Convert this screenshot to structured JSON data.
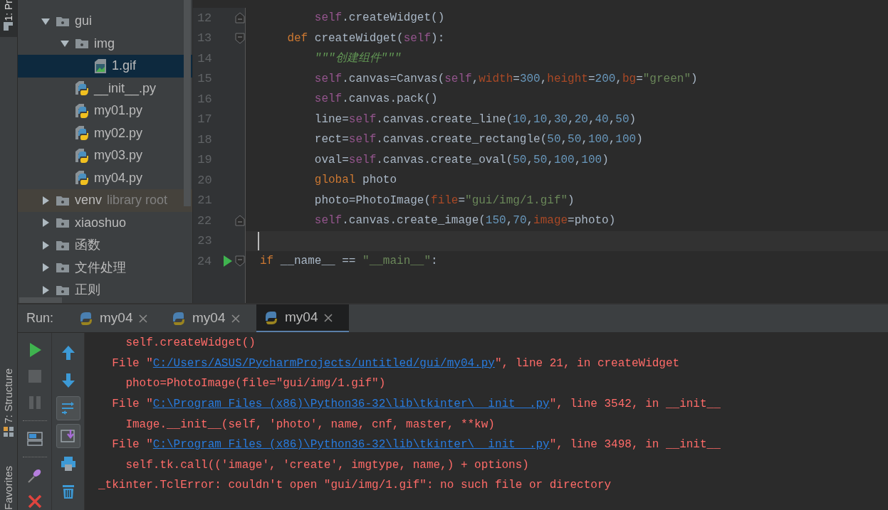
{
  "tool_strip": {
    "top_label": "1: Pr",
    "structure_label": "7: Structure",
    "favorites_label": "Favorites"
  },
  "project_tree": [
    {
      "kind": "folder",
      "label": "gui",
      "expanded": true,
      "selected": false,
      "children": [
        {
          "kind": "folder",
          "label": "img",
          "expanded": true,
          "selected": false,
          "children": [
            {
              "kind": "image",
              "label": "1.gif",
              "selected": true
            }
          ]
        },
        {
          "kind": "python",
          "label": "__init__.py",
          "selected": false
        },
        {
          "kind": "python",
          "label": "my01.py",
          "selected": false
        },
        {
          "kind": "python",
          "label": "my02.py",
          "selected": false
        },
        {
          "kind": "python",
          "label": "my03.py",
          "selected": false
        },
        {
          "kind": "python",
          "label": "my04.py",
          "selected": false
        }
      ]
    },
    {
      "kind": "folder",
      "label": "venv",
      "note": "library root",
      "expanded": false,
      "selected": false
    },
    {
      "kind": "folder",
      "label": "xiaoshuo",
      "expanded": false,
      "selected": false
    },
    {
      "kind": "folder",
      "label": "函数",
      "expanded": false,
      "selected": false
    },
    {
      "kind": "folder",
      "label": "文件处理",
      "expanded": false,
      "selected": false
    },
    {
      "kind": "folder",
      "label": "正则",
      "expanded": false,
      "selected": false
    }
  ],
  "editor": {
    "lines": [
      {
        "number": "12",
        "fold_start": false,
        "fold_end": true,
        "current": false,
        "run": false,
        "tokens": [
          {
            "kind": "self",
            "text": "        self"
          },
          {
            "kind": "plain",
            "text": ".createWidget()"
          }
        ]
      },
      {
        "number": "13",
        "fold_start": true,
        "fold_end": false,
        "current": false,
        "run": false,
        "tokens": [
          {
            "kind": "keyword",
            "text": "    def "
          },
          {
            "kind": "plain",
            "text": "createWidget("
          },
          {
            "kind": "self",
            "text": "self"
          },
          {
            "kind": "plain",
            "text": "):"
          }
        ]
      },
      {
        "number": "14",
        "fold_start": false,
        "fold_end": false,
        "current": false,
        "run": false,
        "tokens": [
          {
            "kind": "docstring",
            "text": "        \"\"\"创建组件\"\"\""
          }
        ]
      },
      {
        "number": "15",
        "fold_start": false,
        "fold_end": false,
        "current": false,
        "run": false,
        "tokens": [
          {
            "kind": "self",
            "text": "        self"
          },
          {
            "kind": "plain",
            "text": ".canvas=Canvas("
          },
          {
            "kind": "self",
            "text": "self"
          },
          {
            "kind": "plain",
            "text": ","
          },
          {
            "kind": "param",
            "text": "width"
          },
          {
            "kind": "plain",
            "text": "="
          },
          {
            "kind": "number",
            "text": "300"
          },
          {
            "kind": "plain",
            "text": ","
          },
          {
            "kind": "param",
            "text": "height"
          },
          {
            "kind": "plain",
            "text": "="
          },
          {
            "kind": "number",
            "text": "200"
          },
          {
            "kind": "plain",
            "text": ","
          },
          {
            "kind": "param",
            "text": "bg"
          },
          {
            "kind": "plain",
            "text": "="
          },
          {
            "kind": "string",
            "text": "\"green\""
          },
          {
            "kind": "plain",
            "text": ")"
          }
        ]
      },
      {
        "number": "16",
        "fold_start": false,
        "fold_end": false,
        "current": false,
        "run": false,
        "tokens": [
          {
            "kind": "self",
            "text": "        self"
          },
          {
            "kind": "plain",
            "text": ".canvas.pack()"
          }
        ]
      },
      {
        "number": "17",
        "fold_start": false,
        "fold_end": false,
        "current": false,
        "run": false,
        "tokens": [
          {
            "kind": "plain",
            "text": "        line="
          },
          {
            "kind": "self",
            "text": "self"
          },
          {
            "kind": "plain",
            "text": ".canvas.create_line("
          },
          {
            "kind": "number",
            "text": "10"
          },
          {
            "kind": "plain",
            "text": ","
          },
          {
            "kind": "number",
            "text": "10"
          },
          {
            "kind": "plain",
            "text": ","
          },
          {
            "kind": "number",
            "text": "30"
          },
          {
            "kind": "plain",
            "text": ","
          },
          {
            "kind": "number",
            "text": "20"
          },
          {
            "kind": "plain",
            "text": ","
          },
          {
            "kind": "number",
            "text": "40"
          },
          {
            "kind": "plain",
            "text": ","
          },
          {
            "kind": "number",
            "text": "50"
          },
          {
            "kind": "plain",
            "text": ")"
          }
        ]
      },
      {
        "number": "18",
        "fold_start": false,
        "fold_end": false,
        "current": false,
        "run": false,
        "tokens": [
          {
            "kind": "plain",
            "text": "        rect="
          },
          {
            "kind": "self",
            "text": "self"
          },
          {
            "kind": "plain",
            "text": ".canvas.create_rectangle("
          },
          {
            "kind": "number",
            "text": "50"
          },
          {
            "kind": "plain",
            "text": ","
          },
          {
            "kind": "number",
            "text": "50"
          },
          {
            "kind": "plain",
            "text": ","
          },
          {
            "kind": "number",
            "text": "100"
          },
          {
            "kind": "plain",
            "text": ","
          },
          {
            "kind": "number",
            "text": "100"
          },
          {
            "kind": "plain",
            "text": ")"
          }
        ]
      },
      {
        "number": "19",
        "fold_start": false,
        "fold_end": false,
        "current": false,
        "run": false,
        "tokens": [
          {
            "kind": "plain",
            "text": "        oval="
          },
          {
            "kind": "self",
            "text": "self"
          },
          {
            "kind": "plain",
            "text": ".canvas.create_oval("
          },
          {
            "kind": "number",
            "text": "50"
          },
          {
            "kind": "plain",
            "text": ","
          },
          {
            "kind": "number",
            "text": "50"
          },
          {
            "kind": "plain",
            "text": ","
          },
          {
            "kind": "number",
            "text": "100"
          },
          {
            "kind": "plain",
            "text": ","
          },
          {
            "kind": "number",
            "text": "100"
          },
          {
            "kind": "plain",
            "text": ")"
          }
        ]
      },
      {
        "number": "20",
        "fold_start": false,
        "fold_end": false,
        "current": false,
        "run": false,
        "tokens": [
          {
            "kind": "keyword",
            "text": "        global "
          },
          {
            "kind": "plain",
            "text": "photo"
          }
        ]
      },
      {
        "number": "21",
        "fold_start": false,
        "fold_end": false,
        "current": false,
        "run": false,
        "tokens": [
          {
            "kind": "plain",
            "text": "        photo=PhotoImage("
          },
          {
            "kind": "param",
            "text": "file"
          },
          {
            "kind": "plain",
            "text": "="
          },
          {
            "kind": "string",
            "text": "\"gui/img/1.gif\""
          },
          {
            "kind": "plain",
            "text": ")"
          }
        ]
      },
      {
        "number": "22",
        "fold_start": false,
        "fold_end": true,
        "current": false,
        "run": false,
        "tokens": [
          {
            "kind": "self",
            "text": "        self"
          },
          {
            "kind": "plain",
            "text": ".canvas.create_image("
          },
          {
            "kind": "number",
            "text": "150"
          },
          {
            "kind": "plain",
            "text": ","
          },
          {
            "kind": "number",
            "text": "70"
          },
          {
            "kind": "plain",
            "text": ","
          },
          {
            "kind": "param",
            "text": "image"
          },
          {
            "kind": "plain",
            "text": "=photo)"
          }
        ]
      },
      {
        "number": "23",
        "fold_start": false,
        "fold_end": false,
        "current": true,
        "run": false
      },
      {
        "number": "24",
        "fold_start": true,
        "fold_end": false,
        "current": false,
        "run": true,
        "tokens": [
          {
            "kind": "keyword",
            "text": "if "
          },
          {
            "kind": "plain",
            "text": "__name__ == "
          },
          {
            "kind": "string",
            "text": "\"__main__\""
          },
          {
            "kind": "plain",
            "text": ":"
          }
        ]
      }
    ]
  },
  "run_panel": {
    "label": "Run:",
    "tabs": [
      {
        "label": "my04",
        "selected": false
      },
      {
        "label": "my04",
        "selected": false
      },
      {
        "label": "my04",
        "selected": true
      }
    ],
    "left_tools": [
      {
        "kind": "run"
      },
      {
        "kind": "stop"
      },
      {
        "kind": "pause"
      },
      {
        "kind": "sep"
      },
      {
        "kind": "layout"
      },
      {
        "kind": "sep"
      },
      {
        "kind": "pin"
      },
      {
        "kind": "close"
      }
    ],
    "right_tools": [
      {
        "kind": "up",
        "on": false
      },
      {
        "kind": "down",
        "on": false
      },
      {
        "kind": "wrap",
        "on": true
      },
      {
        "kind": "scroll",
        "on": true
      },
      {
        "kind": "print",
        "on": false
      },
      {
        "kind": "trash",
        "on": false
      }
    ],
    "console": [
      {
        "kind": "text",
        "text": "    self.createWidget()"
      },
      {
        "kind": "file",
        "prefix": "  File \"",
        "link": "C:/Users/ASUS/PycharmProjects/untitled/gui/my04.py",
        "suffix": "\", line 21, in createWidget"
      },
      {
        "kind": "text",
        "text": "    photo=PhotoImage(file=\"gui/img/1.gif\")"
      },
      {
        "kind": "file",
        "prefix": "  File \"",
        "link": "C:\\Program Files (x86)\\Python36-32\\lib\\tkinter\\__init__.py",
        "suffix": "\", line 3542, in __init__"
      },
      {
        "kind": "text",
        "text": "    Image.__init__(self, 'photo', name, cnf, master, **kw)"
      },
      {
        "kind": "file",
        "prefix": "  File \"",
        "link": "C:\\Program Files (x86)\\Python36-32\\lib\\tkinter\\__init__.py",
        "suffix": "\", line 3498, in __init__"
      },
      {
        "kind": "text",
        "text": "    self.tk.call(('image', 'create', imgtype, name,) + options)"
      },
      {
        "kind": "text",
        "text": "_tkinter.TclError: couldn't open \"gui/img/1.gif\": no such file or directory"
      }
    ]
  }
}
